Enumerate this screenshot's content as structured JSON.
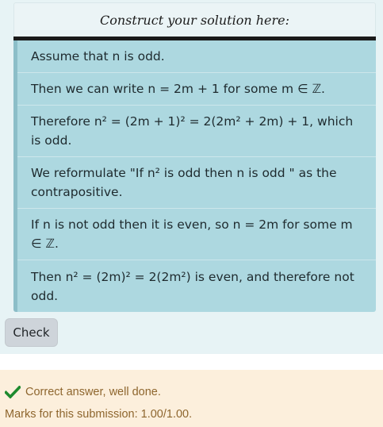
{
  "header": {
    "prompt": "Construct your solution here:"
  },
  "steps": [
    {
      "text": "Assume that n is odd."
    },
    {
      "text": "Then we can write n = 2m + 1 for some m ∈ ℤ."
    },
    {
      "text": "Therefore n² = (2m + 1)² = 2(2m² + 2m) + 1, which is odd."
    },
    {
      "text": "We reformulate \"If n² is odd then n is odd \" as the contrapositive."
    },
    {
      "text": "If n is not odd then it is even, so n = 2m for some m ∈ ℤ."
    },
    {
      "text": "Then n² = (2m)² = 2(2m²) is even, and therefore not odd."
    }
  ],
  "actions": {
    "check_label": "Check"
  },
  "feedback": {
    "status_text": "Correct answer, well done.",
    "marks_text": "Marks for this submission: 1.00/1.00.",
    "icon": "checkmark-icon",
    "accent_color": "#1e8a2e"
  }
}
